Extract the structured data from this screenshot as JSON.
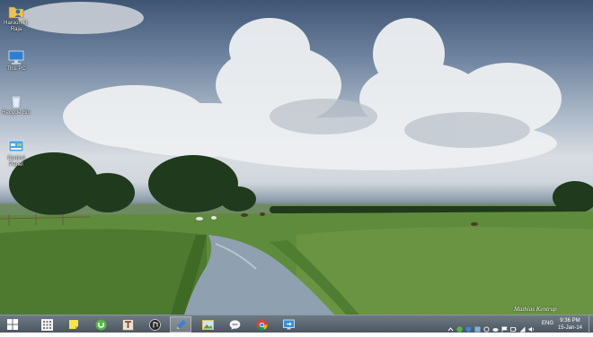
{
  "desktop": {
    "icons": [
      {
        "label": "Haroon Q. Raja",
        "icon": "user-folder-icon"
      },
      {
        "label": "This PC",
        "icon": "this-pc-icon"
      },
      {
        "label": "Recycle Bin",
        "icon": "recycle-bin-icon"
      },
      {
        "label": "Control Panel",
        "icon": "control-panel-icon"
      }
    ],
    "watermark": "Mathias Kentrup"
  },
  "taskbar": {
    "start_icon": "windows-start-icon",
    "pinned": [
      {
        "name": "apps-grid",
        "icon": "apps-grid-icon"
      },
      {
        "name": "sticky-notes",
        "icon": "sticky-notes-icon"
      },
      {
        "name": "utorrent",
        "icon": "utorrent-icon"
      },
      {
        "name": "text-editor",
        "icon": "text-editor-icon"
      },
      {
        "name": "media-player",
        "icon": "media-player-icon"
      },
      {
        "name": "paint",
        "icon": "paint-icon",
        "active": true
      },
      {
        "name": "photo-viewer",
        "icon": "photo-viewer-icon"
      },
      {
        "name": "messenger",
        "icon": "messenger-icon"
      },
      {
        "name": "chrome",
        "icon": "chrome-icon"
      },
      {
        "name": "remote-desktop",
        "icon": "remote-desktop-icon"
      }
    ],
    "tray": {
      "language": "ENG",
      "time": "9:36 PM",
      "date": "15-Jan-14"
    }
  },
  "colors": {
    "taskbar": "#56616b",
    "sky": "#6d839f",
    "grass": "#5e8a3a",
    "water": "#8fa0b0"
  }
}
